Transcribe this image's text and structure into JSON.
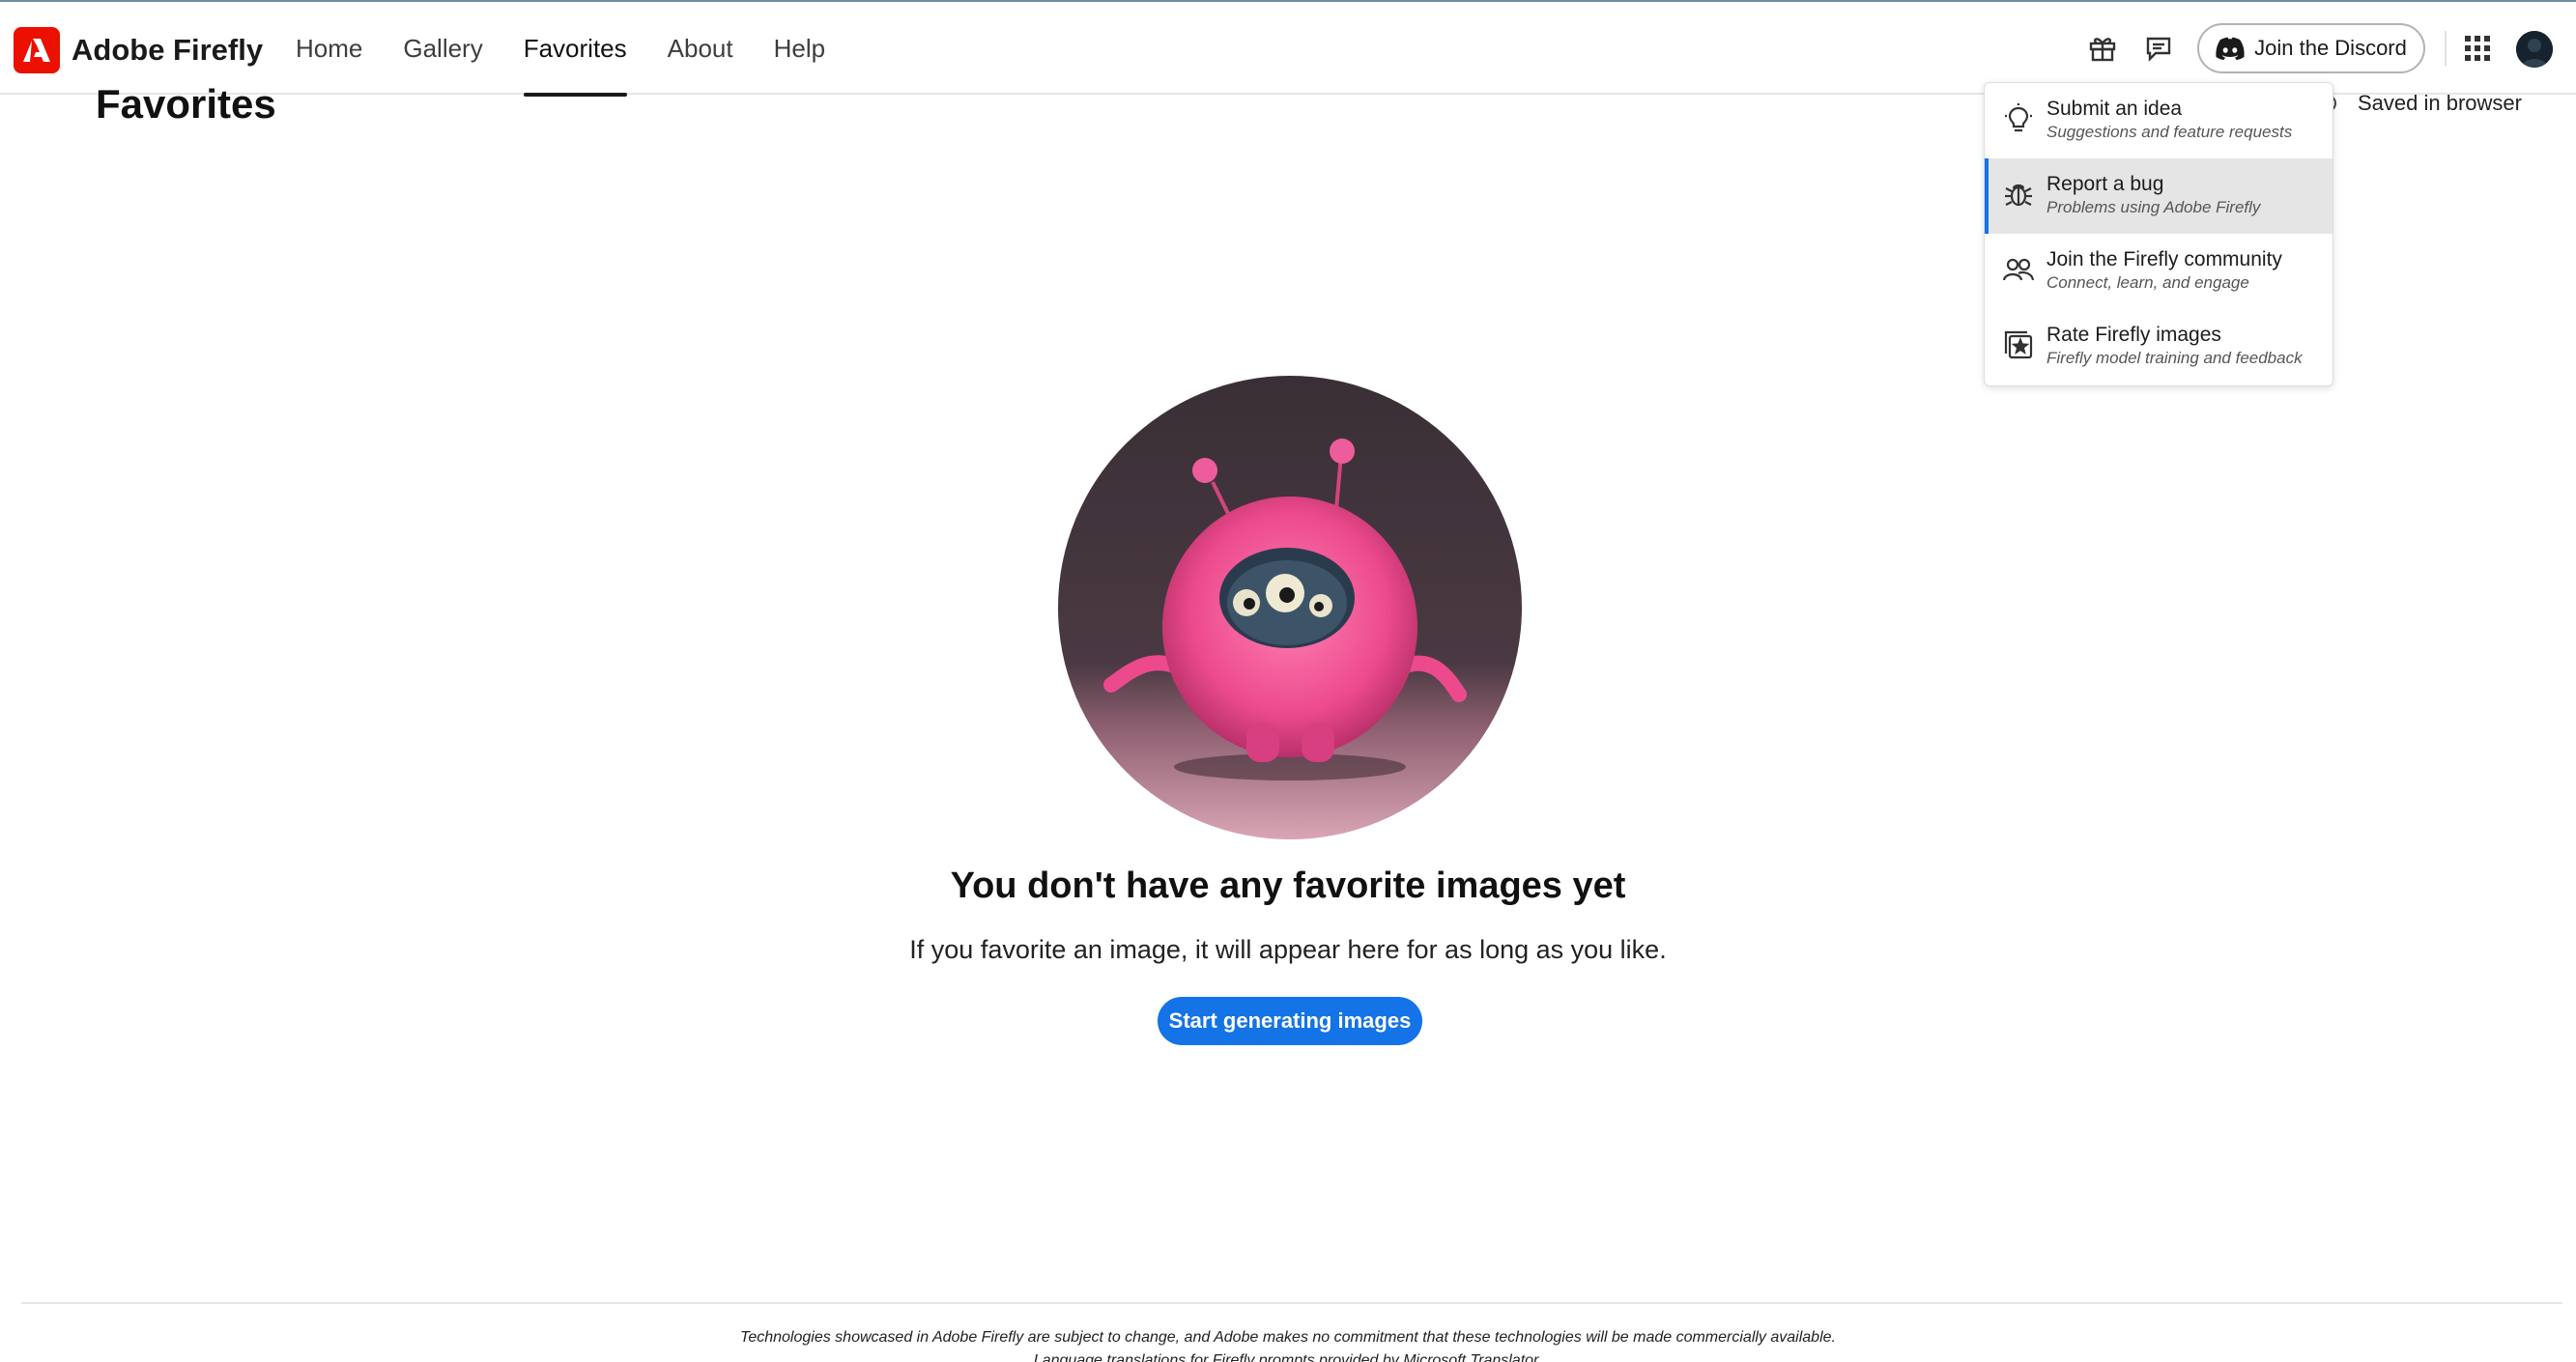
{
  "app": {
    "name": "Adobe Firefly",
    "brand_color": "#eb1000",
    "accent_color": "#1473e6"
  },
  "nav": {
    "items": [
      {
        "label": "Home"
      },
      {
        "label": "Gallery"
      },
      {
        "label": "Favorites",
        "active": true
      },
      {
        "label": "About"
      },
      {
        "label": "Help"
      }
    ]
  },
  "header": {
    "icons": [
      "gift-icon",
      "feedback-icon",
      "discord-icon",
      "apps-grid-icon",
      "avatar"
    ],
    "discord_label": "Join the Discord"
  },
  "page": {
    "title": "Favorites",
    "saved_label": "Saved in browser"
  },
  "feedback_menu": {
    "items": [
      {
        "label": "Submit an idea",
        "desc": "Suggestions and feature requests",
        "icon": "lightbulb-icon"
      },
      {
        "label": "Report a bug",
        "desc": "Problems using Adobe Firefly",
        "icon": "bug-icon",
        "highlighted": true
      },
      {
        "label": "Join the Firefly community",
        "desc": "Connect, learn, and engage",
        "icon": "community-icon"
      },
      {
        "label": "Rate Firefly images",
        "desc": "Firefly model training and feedback",
        "icon": "rate-images-icon"
      }
    ]
  },
  "empty_state": {
    "title": "You don't have any favorite images yet",
    "subtitle": "If you favorite an image, it will appear here for as long as you like.",
    "cta_label": "Start generating images"
  },
  "footer": {
    "line1": "Technologies showcased in Adobe Firefly are subject to change, and Adobe makes no commitment that these technologies will be made commercially available.",
    "line2": "Language translations for Firefly prompts provided by Microsoft Translator."
  }
}
